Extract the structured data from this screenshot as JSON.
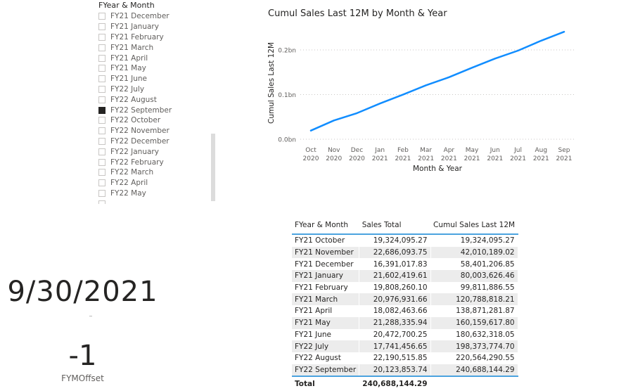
{
  "slicer": {
    "title": "FYear & Month",
    "items": [
      {
        "label": "FY21 December",
        "checked": false
      },
      {
        "label": "FY21 January",
        "checked": false
      },
      {
        "label": "FY21 February",
        "checked": false
      },
      {
        "label": "FY21 March",
        "checked": false
      },
      {
        "label": "FY21 April",
        "checked": false
      },
      {
        "label": "FY21 May",
        "checked": false
      },
      {
        "label": "FY21 June",
        "checked": false
      },
      {
        "label": "FY22 July",
        "checked": false
      },
      {
        "label": "FY22 August",
        "checked": false
      },
      {
        "label": "FY22 September",
        "checked": true
      },
      {
        "label": "FY22 October",
        "checked": false
      },
      {
        "label": "FY22 November",
        "checked": false
      },
      {
        "label": "FY22 December",
        "checked": false
      },
      {
        "label": "FY22 January",
        "checked": false
      },
      {
        "label": "FY22 February",
        "checked": false
      },
      {
        "label": "FY22 March",
        "checked": false
      },
      {
        "label": "FY22 April",
        "checked": false
      },
      {
        "label": "FY22 May",
        "checked": false
      }
    ]
  },
  "chart_data": {
    "type": "line",
    "title": "Cumul Sales Last 12M by Month & Year",
    "xlabel": "Month & Year",
    "ylabel": "Cumul Sales Last 12M",
    "categories": [
      [
        "Oct",
        "2020"
      ],
      [
        "Nov",
        "2020"
      ],
      [
        "Dec",
        "2020"
      ],
      [
        "Jan",
        "2021"
      ],
      [
        "Feb",
        "2021"
      ],
      [
        "Mar",
        "2021"
      ],
      [
        "Apr",
        "2021"
      ],
      [
        "May",
        "2021"
      ],
      [
        "Jun",
        "2021"
      ],
      [
        "Jul",
        "2021"
      ],
      [
        "Aug",
        "2021"
      ],
      [
        "Sep",
        "2021"
      ]
    ],
    "series": [
      {
        "name": "Cumul Sales Last 12M",
        "color": "#118dff",
        "values": [
          19324095.27,
          42010189.02,
          58401206.85,
          80003626.46,
          99811886.55,
          120788818.21,
          138871281.87,
          160159617.8,
          180632318.05,
          198373774.7,
          220564290.55,
          240688144.29
        ]
      }
    ],
    "yticks": [
      {
        "value": 0,
        "label": "0.0bn"
      },
      {
        "value": 100000000,
        "label": "0.1bn"
      },
      {
        "value": 200000000,
        "label": "0.2bn"
      }
    ],
    "ylim": [
      0,
      250000000
    ],
    "grid": true,
    "legend": "none"
  },
  "card": {
    "date_value": "9/30/2021",
    "offset_value": "-1",
    "offset_label": "FYMOffset"
  },
  "table": {
    "headers": [
      "FYear & Month",
      "Sales Total",
      "Cumul Sales Last 12M"
    ],
    "rows": [
      [
        "FY21 October",
        "19,324,095.27",
        "19,324,095.27"
      ],
      [
        "FY21 November",
        "22,686,093.75",
        "42,010,189.02"
      ],
      [
        "FY21 December",
        "16,391,017.83",
        "58,401,206.85"
      ],
      [
        "FY21 January",
        "21,602,419.61",
        "80,003,626.46"
      ],
      [
        "FY21 February",
        "19,808,260.10",
        "99,811,886.55"
      ],
      [
        "FY21 March",
        "20,976,931.66",
        "120,788,818.21"
      ],
      [
        "FY21 April",
        "18,082,463.66",
        "138,871,281.87"
      ],
      [
        "FY21 May",
        "21,288,335.94",
        "160,159,617.80"
      ],
      [
        "FY21 June",
        "20,472,700.25",
        "180,632,318.05"
      ],
      [
        "FY22 July",
        "17,741,456.65",
        "198,373,774.70"
      ],
      [
        "FY22 August",
        "22,190,515.85",
        "220,564,290.55"
      ],
      [
        "FY22 September",
        "20,123,853.74",
        "240,688,144.29"
      ]
    ],
    "total": {
      "label": "Total",
      "sales_total": "240,688,144.29",
      "cumul": ""
    }
  }
}
